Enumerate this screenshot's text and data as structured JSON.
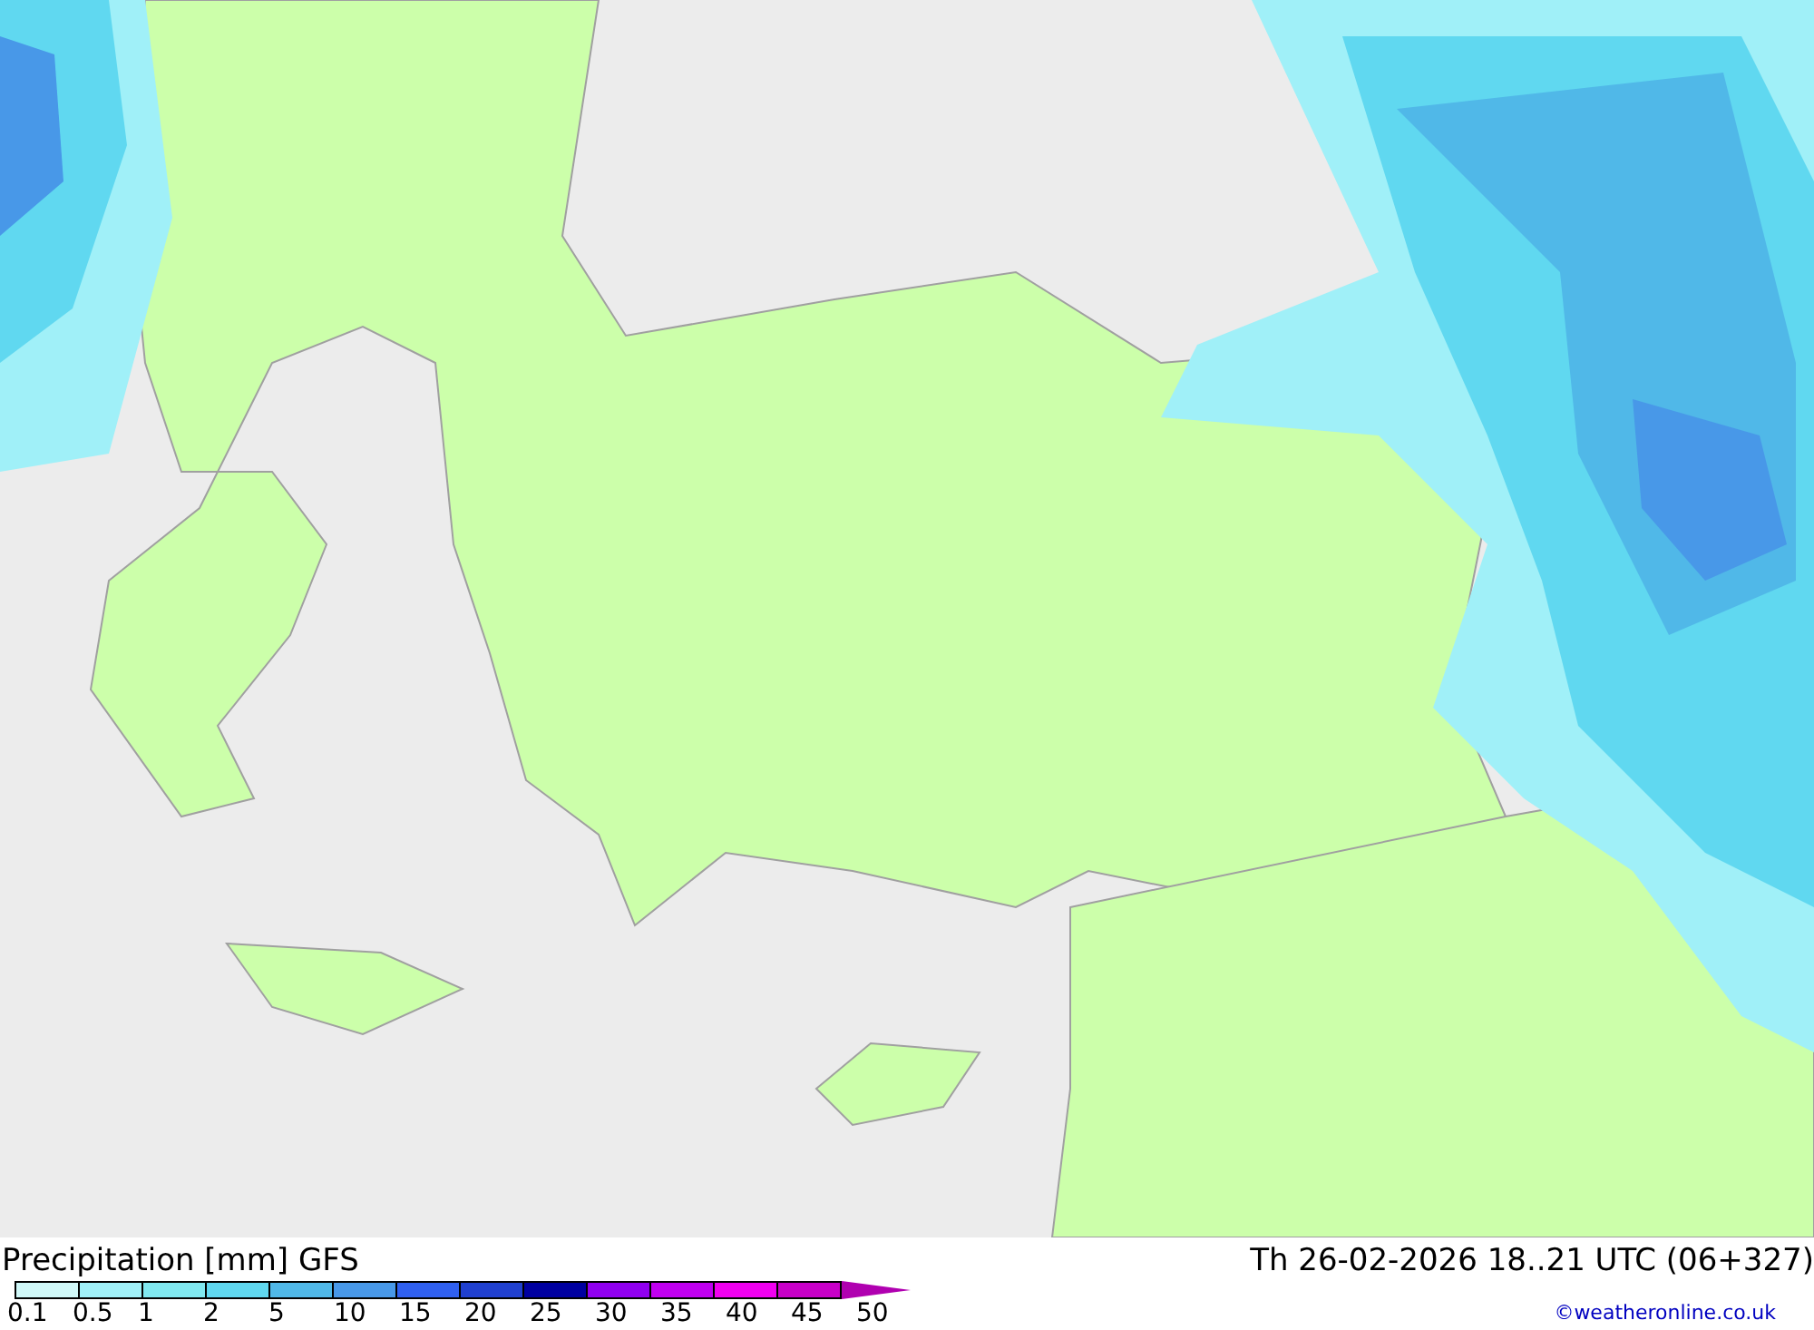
{
  "map": {
    "kind": "precipitation"
  },
  "footer": {
    "title": "Precipitation [mm] GFS",
    "valid_time": "Th 26-02-2026 18..21 UTC (06+327)",
    "credit": "©weatheronline.co.uk"
  },
  "legend": {
    "steps": [
      {
        "color": "#d0f8f8"
      },
      {
        "color": "#a0f0f8"
      },
      {
        "color": "#80e8f0"
      },
      {
        "color": "#60d8f0"
      },
      {
        "color": "#50b8e8"
      },
      {
        "color": "#4898e8"
      },
      {
        "color": "#3060f0"
      },
      {
        "color": "#2040d0"
      },
      {
        "color": "#0000a0"
      },
      {
        "color": "#9000f0"
      },
      {
        "color": "#c000f0"
      },
      {
        "color": "#f000f0"
      },
      {
        "color": "#c800c8"
      }
    ],
    "labels": [
      "0.1",
      "0.5",
      "1",
      "2",
      "5",
      "10",
      "15",
      "20",
      "25",
      "30",
      "35",
      "40",
      "45",
      "50"
    ]
  }
}
